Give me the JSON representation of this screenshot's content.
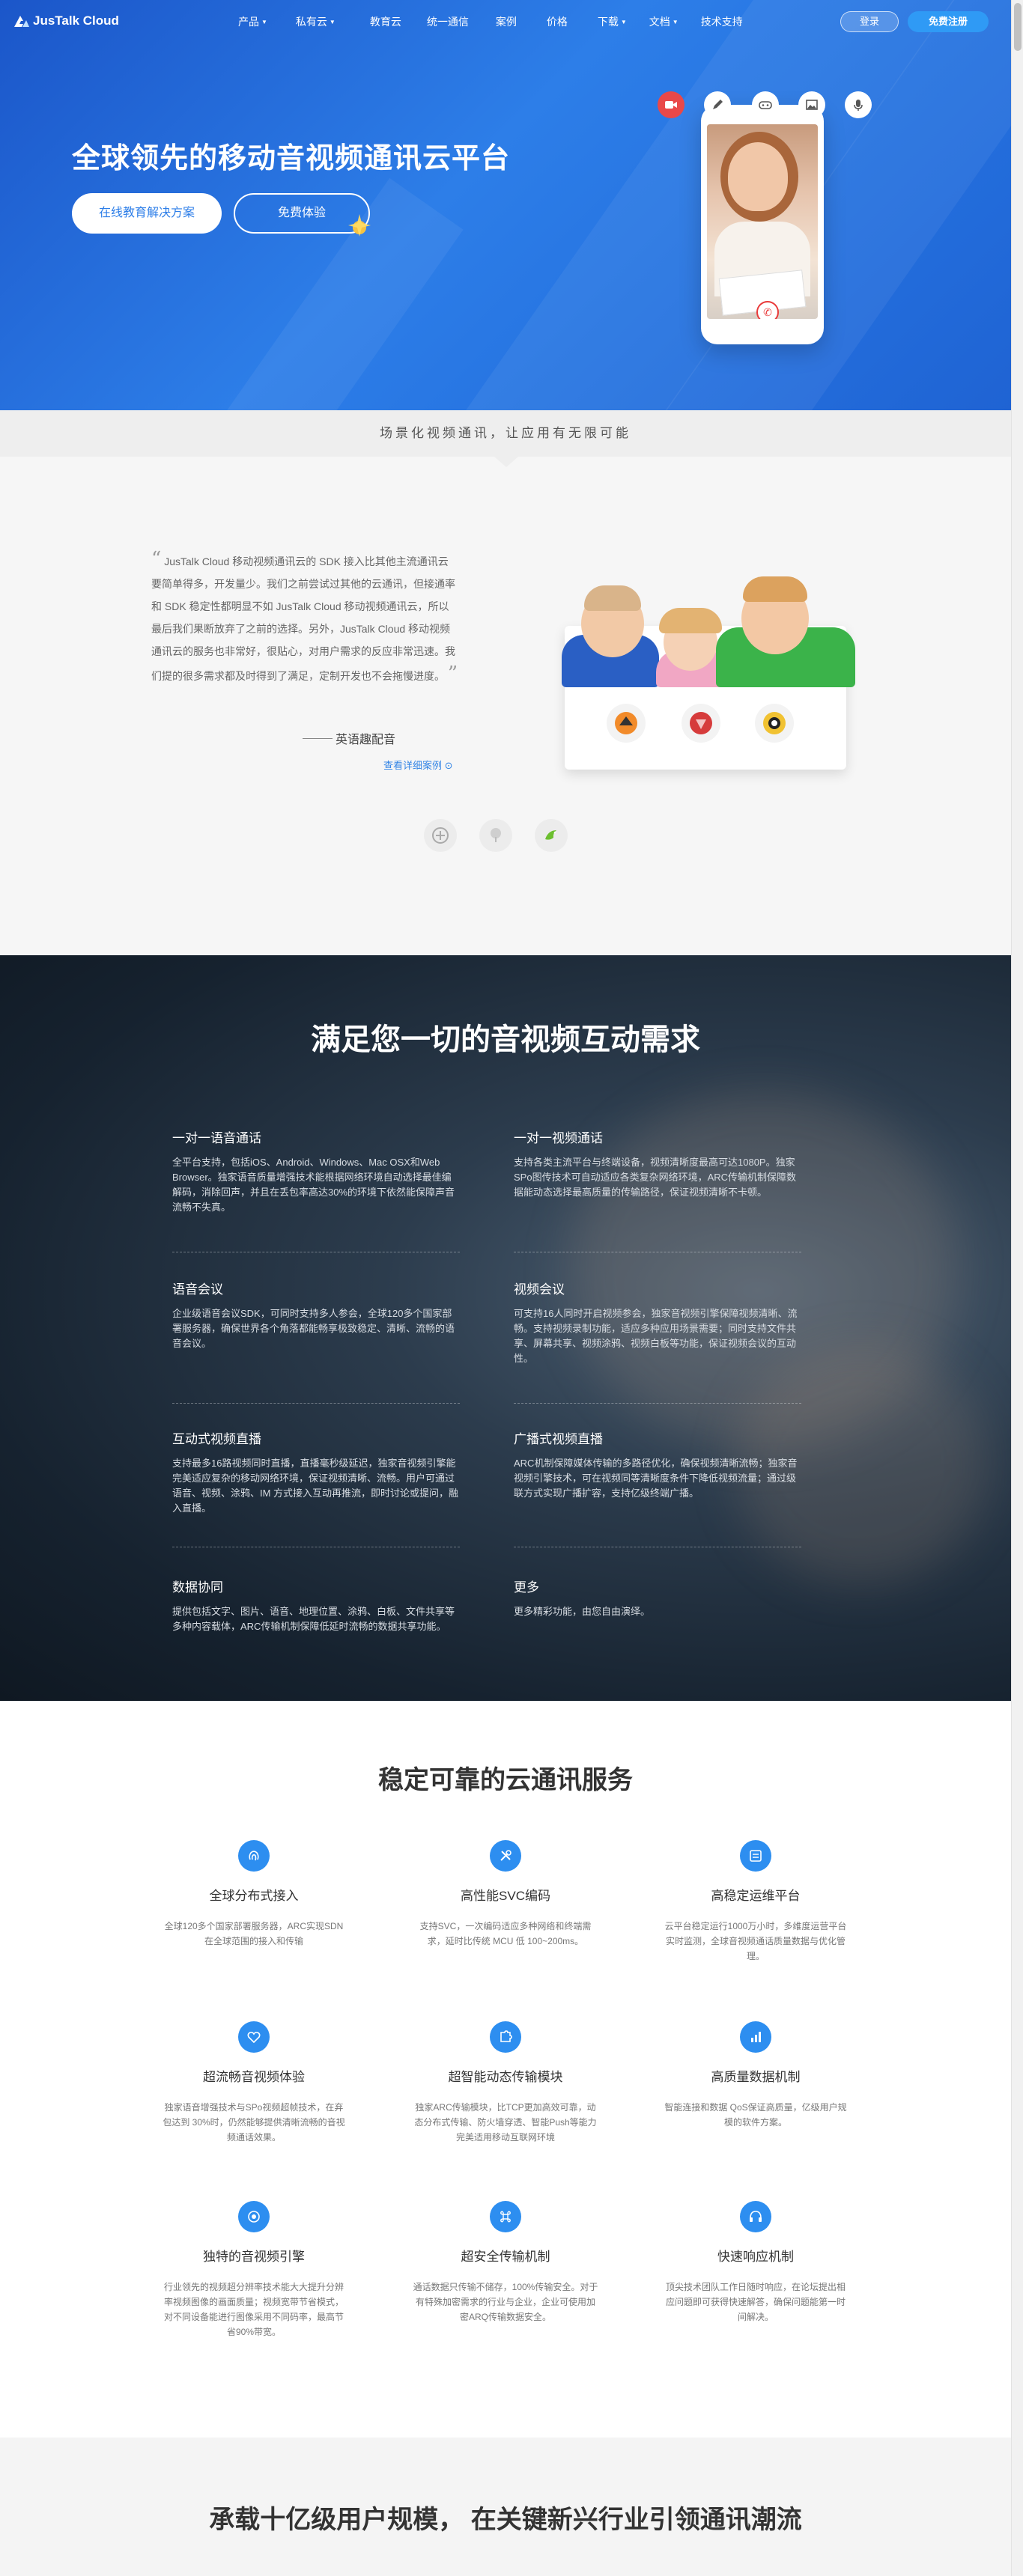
{
  "nav": {
    "logo": "JusTalk Cloud",
    "items": [
      {
        "label": "产品",
        "dropdown": true
      },
      {
        "label": "私有云",
        "dropdown": true
      },
      {
        "label": "教育云",
        "dropdown": false
      },
      {
        "label": "统一通信",
        "dropdown": false
      },
      {
        "label": "案例",
        "dropdown": false
      },
      {
        "label": "价格",
        "dropdown": false
      },
      {
        "label": "下载",
        "dropdown": true
      },
      {
        "label": "文档",
        "dropdown": true
      },
      {
        "label": "技术支持",
        "dropdown": false
      }
    ],
    "login": "登录",
    "register": "免费注册"
  },
  "hero": {
    "title": "全球领先的移动音视频通讯云平台",
    "btn_solution": "在线教育解决方案",
    "btn_trial": "免费体验",
    "icons": [
      "video-icon",
      "pen-icon",
      "gamepad-icon",
      "image-icon",
      "mic-icon"
    ]
  },
  "tagline": "场景化视频通讯，让应用有无限可能",
  "testimonial": {
    "text": "JusTalk Cloud 移动视频通讯云的 SDK 接入比其他主流通讯云要简单得多，开发量少。我们之前尝试过其他的云通讯，但接通率和 SDK 稳定性都明显不如 JusTalk Cloud 移动视频通讯云，所以最后我们果断放弃了之前的选择。另外，JusTalk Cloud 移动视频通讯云的服务也非常好，很贴心，对用户需求的反应非常迅速。我们提的很多需求都及时得到了满足，定制开发也不会拖慢进度。",
    "author": "英语趣配音",
    "link": "查看详细案例"
  },
  "features": {
    "title": "满足您一切的音视频互动需求",
    "items": [
      {
        "title": "一对一语音通话",
        "desc": "全平台支持，包括iOS、Android、Windows、Mac OSX和Web Browser。独家语音质量增强技术能根据网络环境自动选择最佳编解码，消除回声，并且在丢包率高达30%的环境下依然能保障声音流畅不失真。"
      },
      {
        "title": "一对一视频通话",
        "desc": "支持各类主流平台与终端设备，视频清晰度最高可达1080P。独家SPo图传技术可自动适应各类复杂网络环境，ARC传输机制保障数据能动态选择最高质量的传输路径，保证视频清晰不卡顿。"
      },
      {
        "title": "语音会议",
        "desc": "企业级语音会议SDK，可同时支持多人参会，全球120多个国家部署服务器，确保世界各个角落都能畅享极致稳定、清晰、流畅的语音会议。"
      },
      {
        "title": "视频会议",
        "desc": "可支持16人同时开启视频参会，独家音视频引擎保障视频清晰、流畅。支持视频录制功能，适应多种应用场景需要；同时支持文件共享、屏幕共享、视频涂鸦、视频白板等功能，保证视频会议的互动性。"
      },
      {
        "title": "互动式视频直播",
        "desc": "支持最多16路视频同时直播，直播毫秒级延迟，独家音视频引擎能完美适应复杂的移动网络环境，保证视频清晰、流畅。用户可通过语音、视频、涂鸦、IM 方式接入互动再推流，即时讨论或提问，融入直播。"
      },
      {
        "title": "广播式视频直播",
        "desc": "ARC机制保障媒体传输的多路径优化，确保视频清晰流畅；独家音视频引擎技术，可在视频同等清晰度条件下降低视频流量；通过级联方式实现广播扩容，支持亿级终端广播。"
      },
      {
        "title": "数据协同",
        "desc": "提供包括文字、图片、语音、地理位置、涂鸦、白板、文件共享等多种内容载体，ARC传输机制保障低延时流畅的数据共享功能。"
      },
      {
        "title": "更多",
        "desc": "更多精彩功能，由您自由演绎。"
      }
    ]
  },
  "services": {
    "title": "稳定可靠的云通讯服务",
    "items": [
      {
        "icon": "fingerprint-icon",
        "title": "全球分布式接入",
        "desc": "全球120多个国家部署服务器，ARC实现SDN在全球范围的接入和传输"
      },
      {
        "icon": "tools-icon",
        "title": "高性能SVC编码",
        "desc": "支持SVC，一次编码适应多种网络和终端需求，延时比传统 MCU 低 100~200ms。"
      },
      {
        "icon": "dashboard-icon",
        "title": "高稳定运维平台",
        "desc": "云平台稳定运行1000万小时，多维度运营平台实时监测，全球音视频通话质量数据与优化管理。"
      },
      {
        "icon": "heart-icon",
        "title": "超流畅音视频体验",
        "desc": "独家语音增强技术与SPo视频超帧技术，在弃包达到 30%时，仍然能够提供清晰流畅的音视频通话效果。"
      },
      {
        "icon": "puzzle-icon",
        "title": "超智能动态传输模块",
        "desc": "独家ARC传输模块，比TCP更加高效可靠，动态分布式传输、防火墙穿透、智能Push等能力完美适用移动互联网环境"
      },
      {
        "icon": "bar-chart-icon",
        "title": "高质量数据机制",
        "desc": "智能连接和数据 QoS保证高质量，亿级用户规模的软件方案。"
      },
      {
        "icon": "target-icon",
        "title": "独特的音视频引擎",
        "desc": "行业领先的视频超分辨率技术能大大提升分辨率视频图像的画面质量；视频宽带节省模式，对不同设备能进行图像采用不同码率，最高节省90%带宽。"
      },
      {
        "icon": "command-icon",
        "title": "超安全传输机制",
        "desc": "通话数据只传输不储存，100%传输安全。对于有特殊加密需求的行业与企业，企业可使用加密ARQ传输数据安全。"
      },
      {
        "icon": "headset-icon",
        "title": "快速响应机制",
        "desc": "顶尖技术团队工作日随时响应，在论坛提出相应问题即可获得快速解答，确保问题能第一时间解决。"
      }
    ]
  },
  "bottom": {
    "title": "承载十亿级用户规模， 在关键新兴行业引领通讯潮流"
  },
  "colors": {
    "hero_blue": "#2d7ee8",
    "accent": "#2d8ef0",
    "register_btn": "#2f9af5",
    "hangup_red": "#e93a3a"
  }
}
